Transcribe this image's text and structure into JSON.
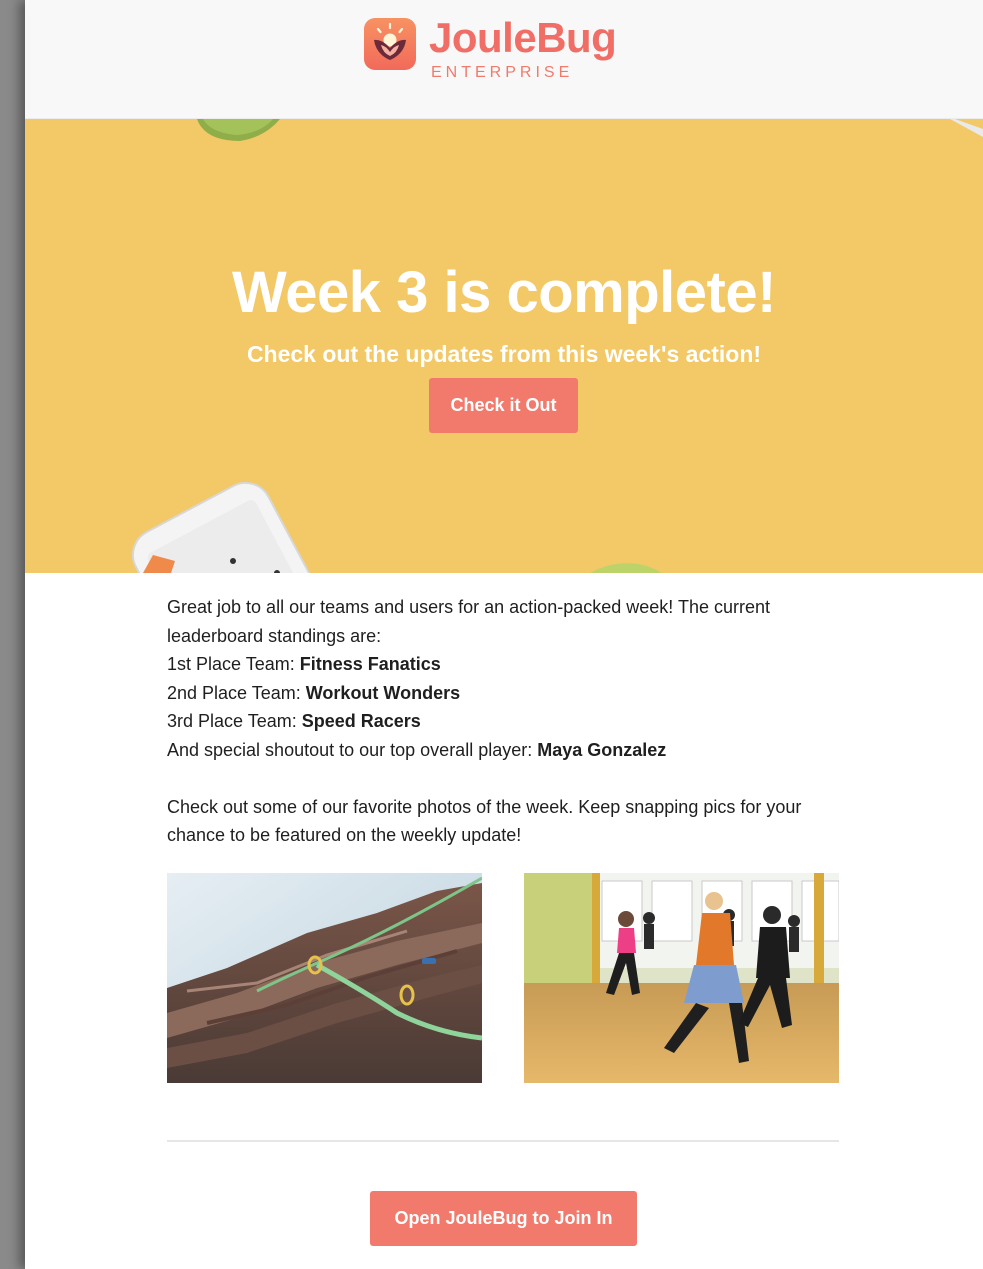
{
  "brand": {
    "name": "JouleBug",
    "tagline": "ENTERPRISE",
    "colors": {
      "accent": "#f27a6c",
      "hero_bg": "#f3c866"
    },
    "icon": "joulebug-logo-icon"
  },
  "hero": {
    "title": "Week 3 is complete!",
    "subtitle": "Check out the updates from this week's action!",
    "button_label": "Check it Out"
  },
  "body": {
    "intro": "Great job to all our teams and users for an action-packed week! The current leaderboard standings are:",
    "standings": [
      {
        "label": "1st Place Team: ",
        "name": "Fitness Fanatics"
      },
      {
        "label": "2nd Place Team: ",
        "name": "Workout Wonders"
      },
      {
        "label": "3rd Place Team: ",
        "name": "Speed Racers"
      }
    ],
    "shoutout_label": "And special shoutout to our top overall player: ",
    "shoutout_name": "Maya Gonzalez",
    "photos_text": "Check out some of our favorite photos of the week. Keep snapping pics for your chance to be featured on the weekly update!"
  },
  "photos": [
    {
      "subject": "rock-climbing-photo"
    },
    {
      "subject": "dance-class-photo"
    }
  ],
  "footer": {
    "button_label": "Open JouleBug to Join In"
  }
}
